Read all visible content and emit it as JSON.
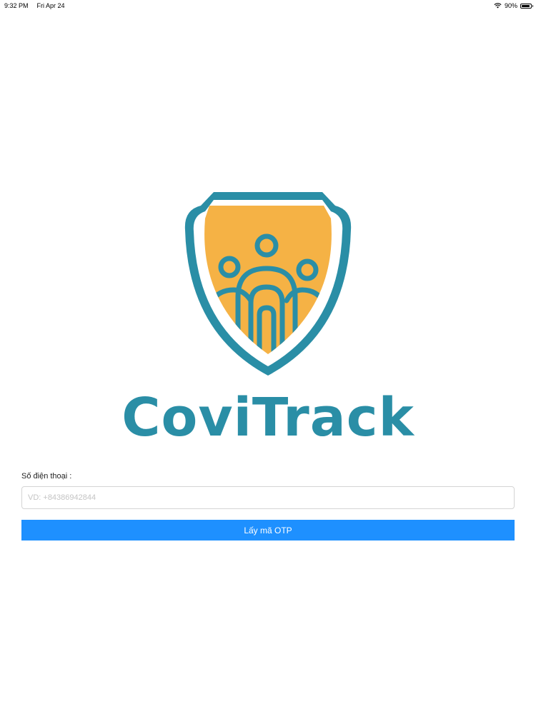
{
  "status_bar": {
    "time": "9:32 PM",
    "date": "Fri Apr 24",
    "battery": "90%",
    "battery_level": 0.9
  },
  "logo": {
    "brand_name": "CoviTrack",
    "colors": {
      "teal": "#2a8ea6",
      "orange": "#f5b245"
    }
  },
  "form": {
    "phone_label": "Số điện thoại :",
    "phone_placeholder": "VD: +84386942844",
    "phone_value": "",
    "otp_button_label": "Lấy mã OTP",
    "button_color": "#1e90ff"
  }
}
